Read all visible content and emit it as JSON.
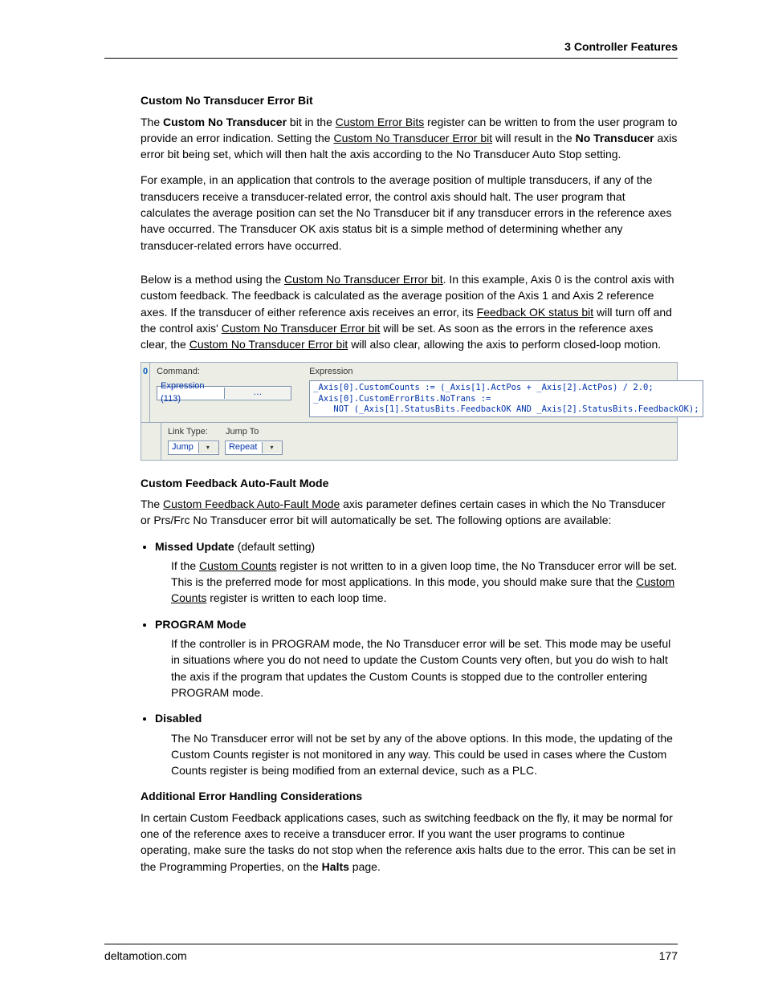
{
  "header": {
    "chapter": "3  Controller Features"
  },
  "sec1": {
    "title": "Custom No Transducer Error Bit",
    "p1_a": "The ",
    "p1_bold1": "Custom No Transducer",
    "p1_b": " bit in the ",
    "p1_link1": "Custom Error Bits",
    "p1_c": " register can be written to from the user program to provide an error indication. Setting the ",
    "p1_link2": "Custom No Transducer Error bit",
    "p1_d": " will result in the ",
    "p1_bold2": "No Transducer",
    "p1_e": " axis error bit being set, which will then halt the axis according to the No Transducer Auto Stop setting.",
    "p2": "For example, in an application that controls to the average position of multiple transducers, if any of the transducers receive a transducer-related error, the control axis should halt. The user program that calculates the average position can set the No Transducer bit if any transducer errors in the reference axes have occurred. The Transducer OK axis status bit is a simple method of determining whether any transducer-related errors have occurred.",
    "p3_a": "Below is a method using the ",
    "p3_link1": "Custom No Transducer Error bit",
    "p3_b": ". In this example, Axis 0 is the control axis with custom feedback. The feedback is calculated as the average position of the Axis 1 and Axis 2 reference axes. If the transducer of either reference axis receives an error, its ",
    "p3_link2": "Feedback OK status bit",
    "p3_c": " will turn off and the control axis' ",
    "p3_link3": "Custom No Transducer Error bit",
    "p3_d": " will be set. As soon as the errors in the reference axes clear, the ",
    "p3_link4": "Custom No Transducer Error bit",
    "p3_e": " will also clear, allowing the axis to perform closed-loop motion."
  },
  "codeblock": {
    "step": "0",
    "cmd_label": "Command:",
    "cmd_value": "Expression (113)",
    "exp_label": "Expression",
    "exp_text": "_Axis[0].CustomCounts := (_Axis[1].ActPos + _Axis[2].ActPos) / 2.0;\n_Axis[0].CustomErrorBits.NoTrans :=\n    NOT (_Axis[1].StatusBits.FeedbackOK AND _Axis[2].StatusBits.FeedbackOK);",
    "link_type_label": "Link Type:",
    "jump_to_label": "Jump To",
    "link_type_value": "Jump",
    "jump_to_value": "Repeat"
  },
  "sec2": {
    "title": "Custom Feedback Auto-Fault Mode",
    "p1_a": "The ",
    "p1_link1": "Custom Feedback Auto-Fault Mode",
    "p1_b": " axis parameter defines certain cases in which the No Transducer or Prs/Frc No Transducer error bit will automatically be set. The following options are available:",
    "items": [
      {
        "title": "Missed Update",
        "title_suffix": "  (default setting)",
        "desc_a": "If the ",
        "desc_link1": "Custom Counts",
        "desc_b": " register is not written to in a given loop time, the No Transducer error will be set. This is the preferred mode for most applications. In this mode, you should make sure that the ",
        "desc_link2": "Custom Counts",
        "desc_c": " register is written to each loop time."
      },
      {
        "title": "PROGRAM Mode",
        "title_suffix": "",
        "desc_plain": "If the controller is in PROGRAM mode, the No Transducer error will be set. This mode may be useful in situations where you do not need to update the Custom Counts very often, but you do wish to halt the axis if the program that updates the Custom Counts is stopped due to the controller entering PROGRAM mode."
      },
      {
        "title": "Disabled",
        "title_suffix": "",
        "desc_plain": "The No Transducer error will not be set by any of the above options. In this mode, the updating of the Custom Counts register is not monitored in any way. This could be used in cases where the Custom Counts register is being modified from an external device, such as a PLC."
      }
    ]
  },
  "sec3": {
    "title": "Additional Error Handling Considerations",
    "p1_a": "In certain Custom Feedback applications cases, such as switching feedback on the fly, it may be normal for one of the reference axes to receive a transducer error. If you want the user programs to continue operating, make sure the tasks do not stop when the reference axis halts due to the error. This can be set in the Programming Properties, on the ",
    "p1_bold": "Halts",
    "p1_b": " page."
  },
  "footer": {
    "site": "deltamotion.com",
    "page": "177"
  }
}
